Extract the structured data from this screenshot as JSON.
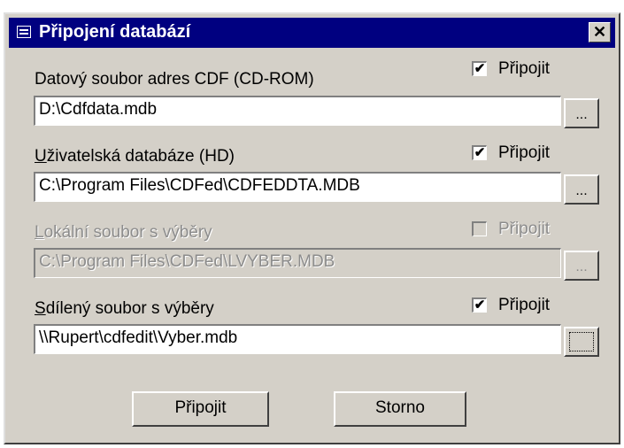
{
  "window": {
    "title": "Připojení databází",
    "close_label": "✕"
  },
  "rows": [
    {
      "label": "Datový soubor adres CDF (CD-ROM)",
      "check_label": "Připojit",
      "checked": "✔",
      "path": "D:\\Cdfdata.mdb",
      "browse_label": "..."
    },
    {
      "label_ul": "U",
      "label_rest": "živatelská databáze (HD)",
      "check_label": "Připojit",
      "checked": "✔",
      "path": "C:\\Program Files\\CDFed\\CDFEDDTA.MDB",
      "browse_label": "..."
    },
    {
      "label_ul": "L",
      "label_rest": "okální soubor s výběry",
      "check_label": "Připojit",
      "checked": "",
      "path": "C:\\Program Files\\CDFed\\LVYBER.MDB",
      "browse_label": "..."
    },
    {
      "label_ul": "S",
      "label_rest": "dílený soubor s výběry",
      "check_label": "Připojit",
      "checked": "✔",
      "path": "\\\\Rupert\\cdfedit\\Vyber.mdb",
      "browse_label": "..."
    }
  ],
  "buttons": {
    "connect_label": "Připojit",
    "cancel_label": "Storno"
  }
}
